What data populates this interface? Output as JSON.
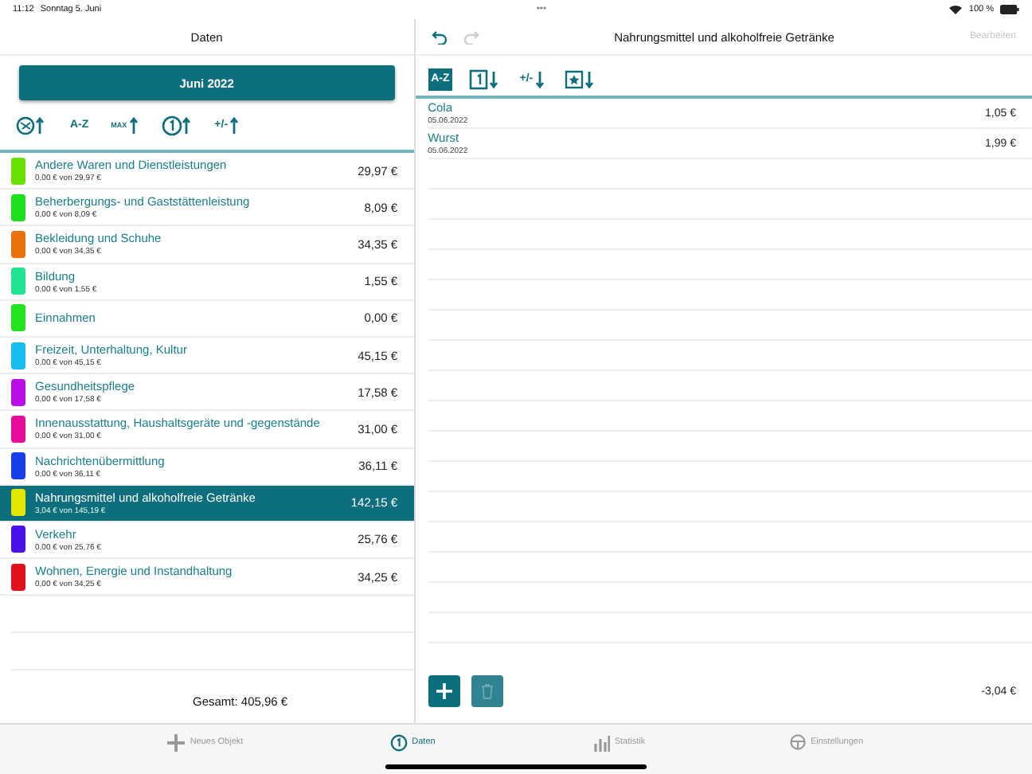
{
  "status_bar": {
    "time": "11:12",
    "date": "Sonntag 5. Juni",
    "dots": "•••",
    "battery": "100 %"
  },
  "left": {
    "title": "Daten",
    "month_button": "Juni 2022",
    "sort_buttons": [
      {
        "kind": "palette",
        "selected": false
      },
      {
        "kind": "text",
        "label": "A-Z",
        "selected": false
      },
      {
        "kind": "max",
        "label": "MAX",
        "selected": false
      },
      {
        "kind": "count",
        "selected": false
      },
      {
        "kind": "sign",
        "label": "+/-",
        "selected": false
      }
    ],
    "categories": [
      {
        "name": "Andere Waren und Dienstleistungen",
        "detail": "0,00 € von 29,97 €",
        "amount": "29,97 €",
        "color": "#66e100",
        "selected": false
      },
      {
        "name": "Beherbergungs- und Gaststättenleistung",
        "detail": "0,00 € von 8,09 €",
        "amount": "8,09 €",
        "color": "#1fe01f",
        "selected": false
      },
      {
        "name": "Bekleidung und Schuhe",
        "detail": "0,00 € von 34,35 €",
        "amount": "34,35 €",
        "color": "#e8710a",
        "selected": false
      },
      {
        "name": "Bildung",
        "detail": "0,00 € von 1,55 €",
        "amount": "1,55 €",
        "color": "#1ee38f",
        "selected": false
      },
      {
        "name": "Einnahmen",
        "amount": "0,00 €",
        "color": "#22e51f",
        "selected": false
      },
      {
        "name": "Freizeit, Unterhaltung, Kultur",
        "detail": "0,00 € von 45,15 €",
        "amount": "45,15 €",
        "color": "#16bdf0",
        "selected": false
      },
      {
        "name": "Gesundheitspflege",
        "detail": "0,00 € von 17,58 €",
        "amount": "17,58 €",
        "color": "#b90ee6",
        "selected": false
      },
      {
        "name": "Innenausstattung, Haushaltsgeräte und -gegenstände",
        "detail": "0,00 € von 31,00 €",
        "amount": "31,00 €",
        "color": "#e80c9a",
        "selected": false
      },
      {
        "name": "Nachrichtenübermittlung",
        "detail": "0,00 € von 36,11 €",
        "amount": "36,11 €",
        "color": "#1740e8",
        "selected": false
      },
      {
        "name": "Nahrungsmittel und alkoholfreie Getränke",
        "detail": "3,04 € von 145,19 €",
        "amount": "142,15 €",
        "color": "#e4e600",
        "selected": true
      },
      {
        "name": "Verkehr",
        "detail": "0,00 € von 25,76 €",
        "amount": "25,76 €",
        "color": "#4a12e8",
        "selected": false
      },
      {
        "name": "Wohnen, Energie und Instandhaltung",
        "detail": "0,00 € von 34,25 €",
        "amount": "34,25 €",
        "color": "#e3101e",
        "selected": false
      }
    ],
    "total": "Gesamt: 405,96 €"
  },
  "right": {
    "title": "Nahrungsmittel und alkoholfreie Getränke",
    "undo_enabled": true,
    "redo_enabled": false,
    "edit_button": {
      "label": "Bearbeiten",
      "disabled": true
    },
    "sort_buttons": [
      {
        "kind": "text",
        "label": "A-Z",
        "selected": true
      },
      {
        "kind": "count",
        "selected": false
      },
      {
        "kind": "sign",
        "label": "+/-",
        "selected": false
      },
      {
        "kind": "star",
        "selected": false
      }
    ],
    "items": [
      {
        "name": "Cola",
        "date": "05.06.2022",
        "amount": "1,05 €"
      },
      {
        "name": "Wurst",
        "date": "05.06.2022",
        "amount": "1,99 €"
      }
    ],
    "delete_disabled": true,
    "total": "-3,04 €"
  },
  "tab_bar": [
    {
      "kind": "plus",
      "label": "Neues Objekt",
      "selected": false
    },
    {
      "kind": "data",
      "label": "Daten",
      "selected": true
    },
    {
      "kind": "chart",
      "label": "Statistik",
      "selected": false
    },
    {
      "kind": "gear",
      "label": "Einstellungen",
      "selected": false
    }
  ]
}
